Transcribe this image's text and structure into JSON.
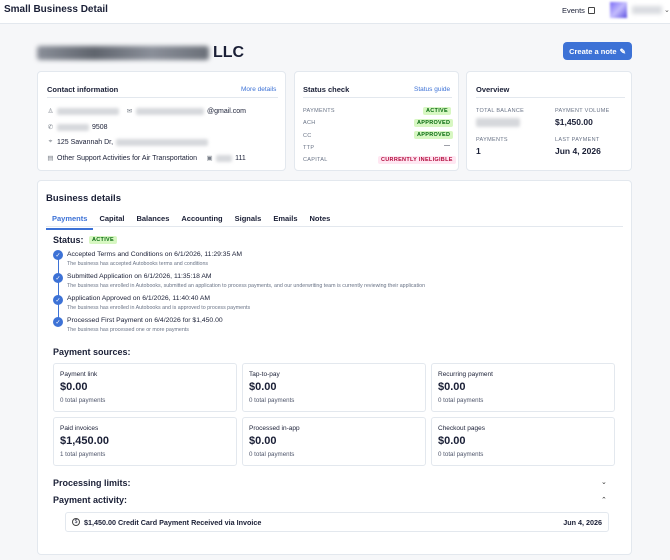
{
  "header": {
    "title": "Small Business Detail",
    "events_label": "Events"
  },
  "company": {
    "name_suffix": "LLC",
    "create_note_label": "Create a note"
  },
  "contact": {
    "title": "Contact information",
    "more_link": "More details",
    "email_suffix": "@gmail.com",
    "phone_suffix": "9508",
    "address_prefix": "125 Savannah Dr,",
    "category": "Other Support Activities for Air Transportation",
    "id_suffix": "111"
  },
  "status_check": {
    "title": "Status check",
    "guide_link": "Status guide",
    "rows": [
      {
        "label": "PAYMENTS",
        "value": "ACTIVE",
        "tone": "green"
      },
      {
        "label": "ACH",
        "value": "APPROVED",
        "tone": "green"
      },
      {
        "label": "CC",
        "value": "APPROVED",
        "tone": "green"
      },
      {
        "label": "TTP",
        "value": "—",
        "tone": "none"
      },
      {
        "label": "CAPITAL",
        "value": "CURRENTLY INELIGIBLE",
        "tone": "red"
      }
    ]
  },
  "overview": {
    "title": "Overview",
    "total_balance_label": "TOTAL BALANCE",
    "payment_volume_label": "PAYMENT VOLUME",
    "payment_volume_value": "$1,450.00",
    "payments_label": "PAYMENTS",
    "payments_value": "1",
    "last_payment_label": "LAST PAYMENT",
    "last_payment_value": "Jun 4, 2026"
  },
  "business": {
    "title": "Business details",
    "tabs": [
      "Payments",
      "Capital",
      "Balances",
      "Accounting",
      "Signals",
      "Emails",
      "Notes"
    ],
    "status_label": "Status:",
    "status_value": "ACTIVE",
    "timeline": [
      {
        "title": "Accepted Terms and Conditions on 6/1/2026, 11:29:35 AM",
        "sub": "The business has accepted Autobooks terms and conditions"
      },
      {
        "title": "Submitted Application on 6/1/2026, 11:35:18 AM",
        "sub": "The business has enrolled in Autobooks, submitted an application to process payments, and our underwriting team is currently reviewing their application"
      },
      {
        "title": "Application Approved on 6/1/2026, 11:40:40 AM",
        "sub": "The business has enrolled in Autobooks and is approved to process payments"
      },
      {
        "title": "Processed First Payment on 6/4/2026 for $1,450.00",
        "sub": "The business has processed one or more payments"
      }
    ],
    "sources_title": "Payment sources:",
    "sources": [
      {
        "title": "Payment link",
        "amount": "$0.00",
        "count": "0 total payments"
      },
      {
        "title": "Tap-to-pay",
        "amount": "$0.00",
        "count": "0 total payments"
      },
      {
        "title": "Recurring payment",
        "amount": "$0.00",
        "count": "0 total payments"
      },
      {
        "title": "Paid invoices",
        "amount": "$1,450.00",
        "count": "1 total payments"
      },
      {
        "title": "Processed in-app",
        "amount": "$0.00",
        "count": "0 total payments"
      },
      {
        "title": "Checkout pages",
        "amount": "$0.00",
        "count": "0 total payments"
      }
    ],
    "limits_title": "Processing limits:",
    "activity_title": "Payment activity:",
    "activity": [
      {
        "desc": "$1,450.00 Credit Card Payment Received via Invoice",
        "date": "Jun 4, 2026"
      }
    ]
  },
  "colors": {
    "accent": "#3d72d6",
    "success_bg": "#d7f7c2",
    "danger_bg": "#ffe7f2"
  }
}
